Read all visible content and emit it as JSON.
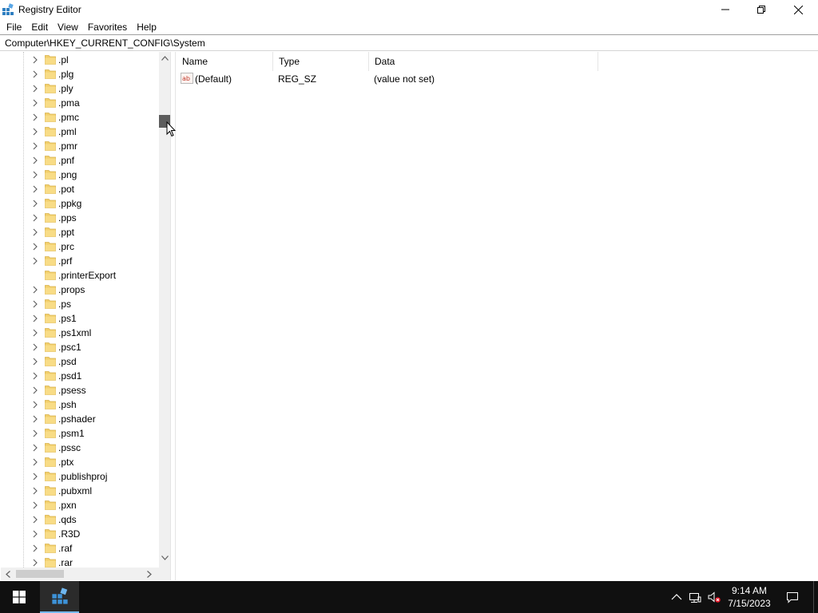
{
  "window": {
    "title": "Registry Editor",
    "minimize_icon": "minimize-icon",
    "restore_icon": "restore-icon",
    "close_icon": "close-icon"
  },
  "menu": [
    "File",
    "Edit",
    "View",
    "Favorites",
    "Help"
  ],
  "address": {
    "path": "Computer\\HKEY_CURRENT_CONFIG\\System"
  },
  "tree": {
    "items": [
      {
        "label": ".pl",
        "expandable": true
      },
      {
        "label": ".plg",
        "expandable": true
      },
      {
        "label": ".ply",
        "expandable": true
      },
      {
        "label": ".pma",
        "expandable": true
      },
      {
        "label": ".pmc",
        "expandable": true
      },
      {
        "label": ".pml",
        "expandable": true
      },
      {
        "label": ".pmr",
        "expandable": true
      },
      {
        "label": ".pnf",
        "expandable": true
      },
      {
        "label": ".png",
        "expandable": true
      },
      {
        "label": ".pot",
        "expandable": true
      },
      {
        "label": ".ppkg",
        "expandable": true
      },
      {
        "label": ".pps",
        "expandable": true
      },
      {
        "label": ".ppt",
        "expandable": true
      },
      {
        "label": ".prc",
        "expandable": true
      },
      {
        "label": ".prf",
        "expandable": true
      },
      {
        "label": ".printerExport",
        "expandable": false
      },
      {
        "label": ".props",
        "expandable": true
      },
      {
        "label": ".ps",
        "expandable": true
      },
      {
        "label": ".ps1",
        "expandable": true
      },
      {
        "label": ".ps1xml",
        "expandable": true
      },
      {
        "label": ".psc1",
        "expandable": true
      },
      {
        "label": ".psd",
        "expandable": true
      },
      {
        "label": ".psd1",
        "expandable": true
      },
      {
        "label": ".psess",
        "expandable": true
      },
      {
        "label": ".psh",
        "expandable": true
      },
      {
        "label": ".pshader",
        "expandable": true
      },
      {
        "label": ".psm1",
        "expandable": true
      },
      {
        "label": ".pssc",
        "expandable": true
      },
      {
        "label": ".ptx",
        "expandable": true
      },
      {
        "label": ".publishproj",
        "expandable": true
      },
      {
        "label": ".pubxml",
        "expandable": true
      },
      {
        "label": ".pxn",
        "expandable": true
      },
      {
        "label": ".qds",
        "expandable": true
      },
      {
        "label": ".R3D",
        "expandable": true
      },
      {
        "label": ".raf",
        "expandable": true
      },
      {
        "label": ".rar",
        "expandable": true
      }
    ]
  },
  "list": {
    "columns": [
      "Name",
      "Type",
      "Data"
    ],
    "rows": [
      {
        "name": "(Default)",
        "type": "REG_SZ",
        "data": "(value not set)",
        "icon": "string-value-icon"
      }
    ]
  },
  "taskbar": {
    "start_icon": "windows-start-icon",
    "app_icon": "registry-editor-icon",
    "tray": [
      "chevron-up-icon",
      "network-icon",
      "volume-muted-icon"
    ],
    "time": "9:14 AM",
    "date": "7/15/2023",
    "notification_icon": "notification-icon"
  },
  "colors": {
    "taskbar": "#101010",
    "active_app_underline": "#76b9ed",
    "folder": "#f2cf6c",
    "scroll_thumb": "#5d5d5d"
  }
}
